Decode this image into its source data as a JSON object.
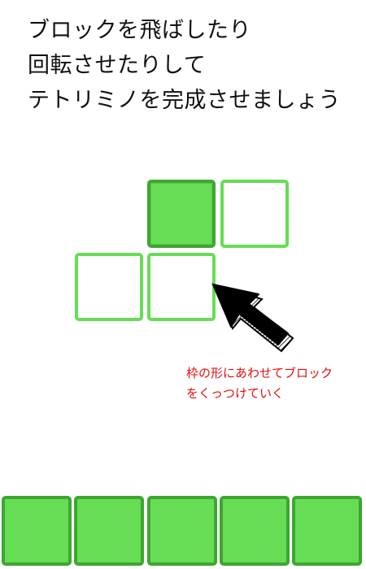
{
  "tutorial": {
    "lines": [
      "ブロックを飛ばしたり",
      "回転させたりして",
      "テトリミノを完成させましょう"
    ],
    "hint_lines": [
      "枠の形にあわせてブロック",
      "をくっつけていく"
    ]
  },
  "colors": {
    "block_fill": "#66dd55",
    "block_border": "#3fa631",
    "slot_border": "#66dd55",
    "hint_text": "#e01010"
  },
  "icons": {
    "cursor": "pointer-arrow-icon"
  }
}
